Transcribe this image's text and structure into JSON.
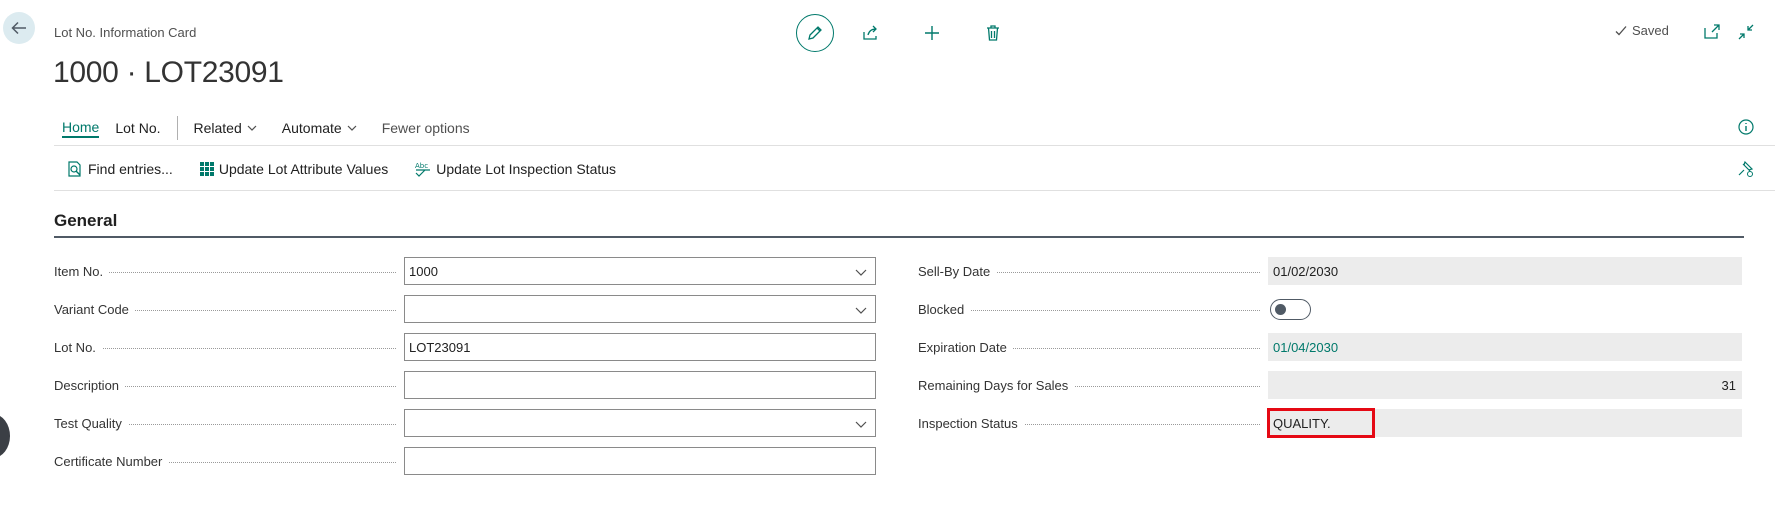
{
  "header": {
    "caption": "Lot No. Information Card",
    "title": "1000 · LOT23091",
    "saved_label": "Saved"
  },
  "tabs": [
    {
      "label": "Home",
      "active": true
    },
    {
      "label": "Lot No."
    },
    {
      "label": "Related",
      "dropdown": true
    },
    {
      "label": "Automate",
      "dropdown": true
    },
    {
      "label": "Fewer options"
    }
  ],
  "actions": [
    {
      "label": "Find entries...",
      "icon": "find-entries-icon"
    },
    {
      "label": "Update Lot Attribute Values",
      "icon": "grid-icon"
    },
    {
      "label": "Update Lot Inspection Status",
      "icon": "abc-check-icon"
    }
  ],
  "section": {
    "title": "General"
  },
  "left_fields": [
    {
      "label": "Item No.",
      "value": "1000",
      "type": "dropdown"
    },
    {
      "label": "Variant Code",
      "value": "",
      "type": "dropdown"
    },
    {
      "label": "Lot No.",
      "value": "LOT23091",
      "type": "text"
    },
    {
      "label": "Description",
      "value": "",
      "type": "text"
    },
    {
      "label": "Test Quality",
      "value": "",
      "type": "dropdown"
    },
    {
      "label": "Certificate Number",
      "value": "",
      "type": "text"
    }
  ],
  "right_fields": [
    {
      "label": "Sell-By Date",
      "value": "01/02/2030"
    },
    {
      "label": "Blocked",
      "value": "off"
    },
    {
      "label": "Expiration Date",
      "value": "01/04/2030"
    },
    {
      "label": "Remaining Days for Sales",
      "value": "31"
    },
    {
      "label": "Inspection Status",
      "value": "QUALITY."
    }
  ],
  "colors": {
    "accent": "#00796b",
    "highlight": "#e50914"
  }
}
